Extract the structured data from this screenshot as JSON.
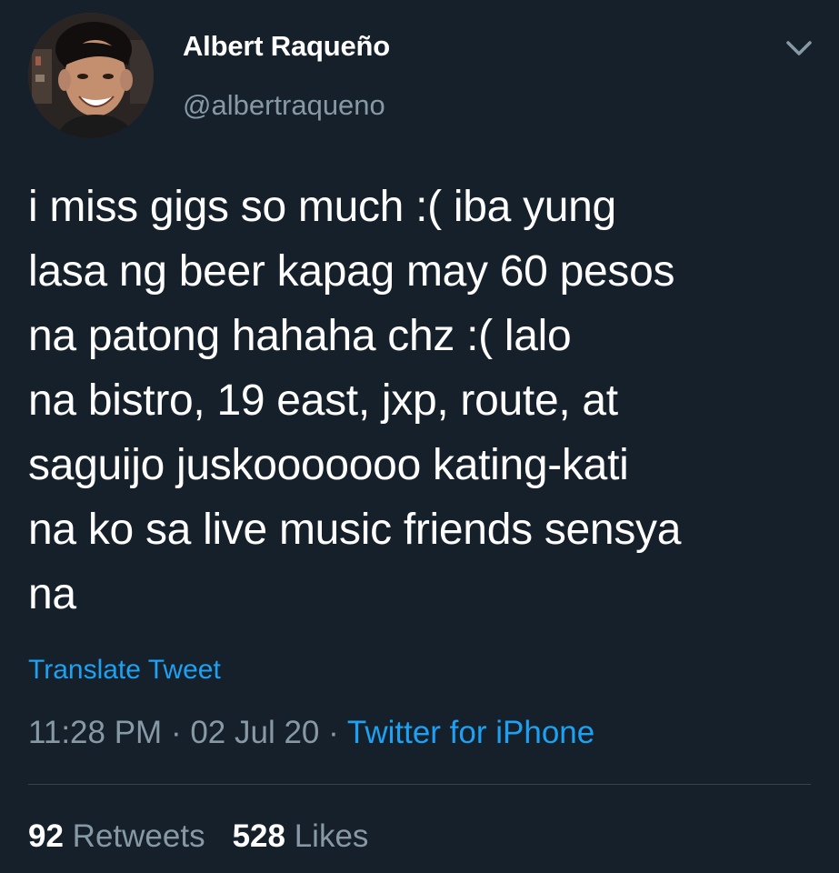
{
  "author": {
    "name": "Albert Raqueño",
    "handle": "@albertraqueno"
  },
  "tweet": {
    "lines": [
      "i miss gigs so much :( iba yung",
      "lasa ng beer kapag may 60 pesos",
      "na patong hahaha chz :( lalo",
      "na bistro, 19 east, jxp, route, at",
      "saguijo juskooooooo kating-kati",
      "na ko sa live music friends sensya",
      "na"
    ],
    "translate_label": "Translate Tweet"
  },
  "meta": {
    "time": "11:28 PM",
    "separator": " · ",
    "date": "02 Jul 20",
    "source": "Twitter for iPhone"
  },
  "stats": {
    "retweets_count": "92",
    "retweets_label": "Retweets",
    "likes_count": "528",
    "likes_label": "Likes"
  },
  "icons": {
    "caret": "chevron-down-icon",
    "avatar": "avatar"
  },
  "colors": {
    "background": "#15202b",
    "text": "#ffffff",
    "secondary": "#8899a6",
    "accent": "#1da1f2",
    "divider": "#38444d"
  }
}
